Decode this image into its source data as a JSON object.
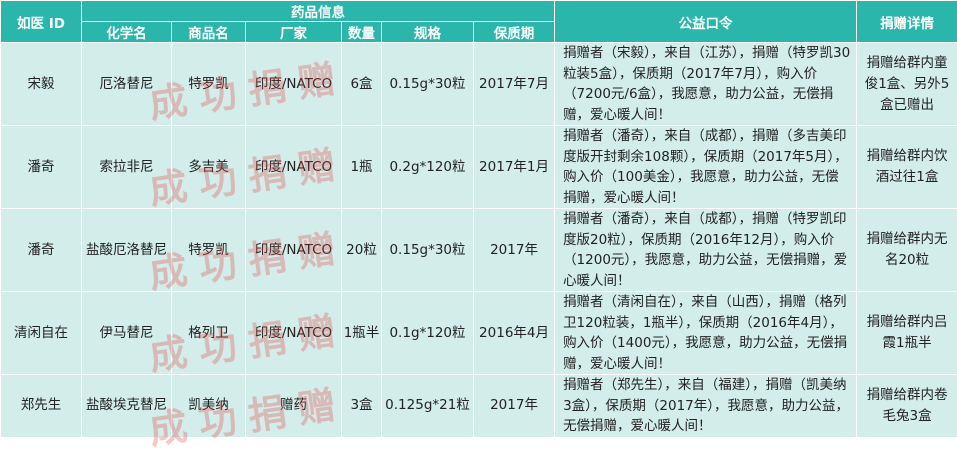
{
  "header": {
    "group_title": "药品信息",
    "columns": [
      "如医 ID",
      "化学名",
      "商品名",
      "厂家",
      "数量",
      "规格",
      "保质期",
      "公益口令",
      "捐赠详情"
    ]
  },
  "rows": [
    {
      "id": "宋毅",
      "chem": "厄洛替尼",
      "brand": "特罗凯",
      "maker": "印度/NATCO",
      "qty": "6盒",
      "spec": "0.15g*30粒",
      "expiry": "2017年7月",
      "slogan": "捐赠者（宋毅），来自（江苏），捐赠（特罗凯30粒装5盒），保质期（2017年7月），购入价（7200元/6盒），我愿意，助力公益，无偿捐赠，爱心暖人间！",
      "detail": "捐赠给群内童俊1盒、另外5盒已赠出"
    },
    {
      "id": "潘奇",
      "chem": "索拉非尼",
      "brand": "多吉美",
      "maker": "印度/NATCO",
      "qty": "1瓶",
      "spec": "0.2g*120粒",
      "expiry": "2017年1月",
      "slogan": "捐赠者（潘奇），来自（成都），捐赠（多吉美印度版开封剩余108颗），保质期（2017年5月），购入价（100美金），我愿意，助力公益，无偿捐赠，爱心暖人间！",
      "detail": "捐赠给群内饮酒过往1盒"
    },
    {
      "id": "潘奇",
      "chem": "盐酸厄洛替尼",
      "brand": "特罗凯",
      "maker": "印度/NATCO",
      "qty": "20粒",
      "spec": "0.15g*30粒",
      "expiry": "2017年",
      "slogan": "捐赠者（潘奇），来自（成都），捐赠（特罗凯印度版20粒），保质期（2016年12月），购入价（1200元），我愿意，助力公益，无偿捐赠，爱心暖人间！",
      "detail": "捐赠给群内无名20粒"
    },
    {
      "id": "清闲自在",
      "chem": "伊马替尼",
      "brand": "格列卫",
      "maker": "印度/NATCO",
      "qty": "1瓶半",
      "spec": "0.1g*120粒",
      "expiry": "2016年4月",
      "slogan": "捐赠者（清闲自在），来自（山西），捐赠（格列卫120粒装，1瓶半），保质期（2016年4月），购入价（1400元），我愿意，助力公益，无偿捐赠，爱心暖人间！",
      "detail": "捐赠给群内吕霞1瓶半"
    },
    {
      "id": "郑先生",
      "chem": "盐酸埃克替尼",
      "brand": "凯美纳",
      "maker": "赠药",
      "qty": "3盒",
      "spec": "0.125g*21粒",
      "expiry": "2017年",
      "slogan": "捐赠者（郑先生），来自（福建），捐赠（凯美纳3盒），保质期（2017年），我愿意，助力公益，无偿捐赠，爱心暖人间！",
      "detail": "捐赠给群内卷毛兔3盒"
    }
  ],
  "watermark": "成功捐赠",
  "colors": {
    "header_bg": "#2bb6ac",
    "row_bg": "#d3edea",
    "watermark": "#e24646"
  }
}
